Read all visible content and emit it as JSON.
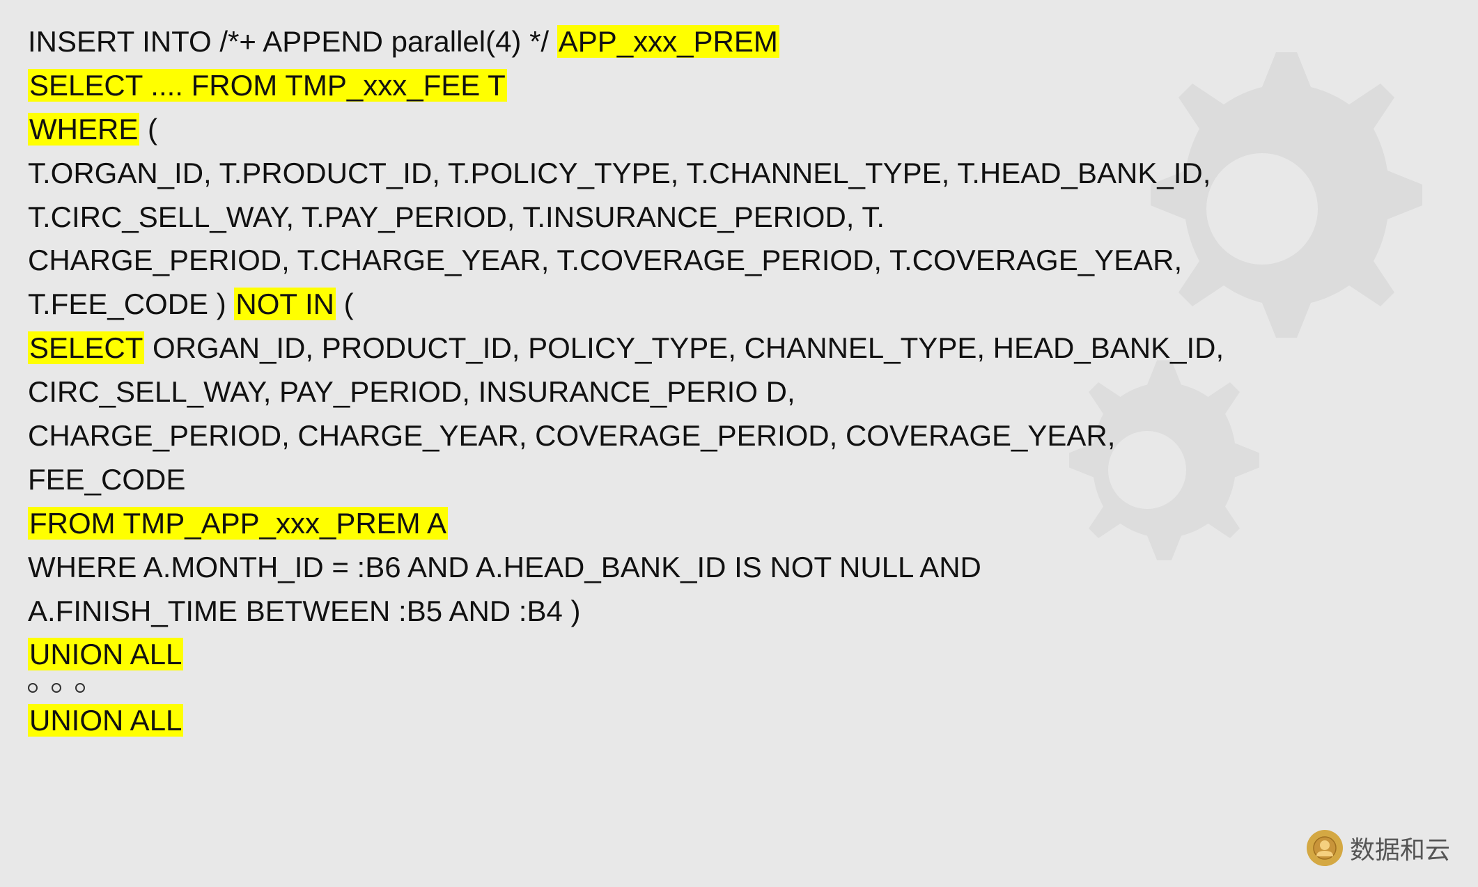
{
  "sql": {
    "line1_normal": "INSERT INTO /*+ APPEND parallel(4) */ ",
    "line1_highlight": "APP_xxx_PREM",
    "line2_highlight": "SELECT .... FROM TMP_xxx_FEE T",
    "line3_highlight": "WHERE",
    "line3_normal": " (",
    "line4": "  T.ORGAN_ID, T.PRODUCT_ID, T.POLICY_TYPE, T.CHANNEL_TYPE, T.HEAD_BANK_ID,",
    "line5": "T.CIRC_SELL_WAY, T.PAY_PERIOD, T.INSURANCE_PERIOD, T.",
    "line6": "  CHARGE_PERIOD, T.CHARGE_YEAR, T.COVERAGE_PERIOD, T.COVERAGE_YEAR,",
    "line7_normal": "T.FEE_CODE  ) ",
    "line7_highlight": "NOT IN",
    "line7_normal2": " (",
    "line8_highlight": "  SELECT",
    "line8_normal": " ORGAN_ID, PRODUCT_ID, POLICY_TYPE, CHANNEL_TYPE, HEAD_BANK_ID,",
    "line9": "CIRC_SELL_WAY, PAY_PERIOD, INSURANCE_PERIO D,",
    "line10": "  CHARGE_PERIOD, CHARGE_YEAR, COVERAGE_PERIOD, COVERAGE_YEAR,",
    "line11": "FEE_CODE",
    "line12_highlight": "  FROM TMP_APP_xxx_PREM A",
    "line13": "  WHERE A.MONTH_ID = :B6   AND A.HEAD_BANK_ID IS NOT NULL   AND",
    "line14": "A.FINISH_TIME BETWEEN :B5   AND :B4  )",
    "line15_highlight": "UNION ALL",
    "dots": [
      "○",
      "○",
      "○"
    ],
    "line16_highlight": "UNION ALL"
  },
  "watermark": {
    "text": "数据和云",
    "icon": "☺"
  }
}
